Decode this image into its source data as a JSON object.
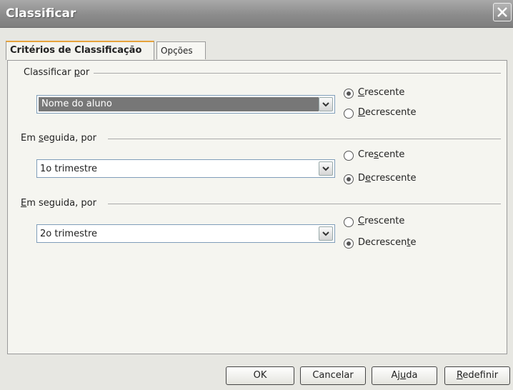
{
  "window": {
    "title": "Classificar"
  },
  "tabs": [
    {
      "label": "Critérios de Classificação"
    },
    {
      "label": "Opções"
    }
  ],
  "groups": [
    {
      "label_pre": "Classificar ",
      "label_key": "p",
      "label_post": "or",
      "select_value": "Nome do aluno",
      "asc": {
        "pre": "",
        "key": "C",
        "post": "rescente",
        "checked": true
      },
      "desc": {
        "pre": "",
        "key": "D",
        "post": "ecrescente",
        "checked": false
      }
    },
    {
      "label_pre": "Em ",
      "label_key": "s",
      "label_post": "eguida, por",
      "select_value": "1o trimestre",
      "asc": {
        "pre": "Cre",
        "key": "s",
        "post": "cente",
        "checked": false
      },
      "desc": {
        "pre": "D",
        "key": "e",
        "post": "crescente",
        "checked": true
      }
    },
    {
      "label_pre": "",
      "label_key": "E",
      "label_post": "m seguida, por",
      "select_value": "2o trimestre",
      "asc": {
        "pre": "",
        "key": "C",
        "post": "rescente",
        "checked": false
      },
      "desc": {
        "pre": "Decrescen",
        "key": "t",
        "post": "e",
        "checked": true
      }
    }
  ],
  "buttons": {
    "ok": "OK",
    "cancel": "Cancelar",
    "help_pre": "Aj",
    "help_key": "u",
    "help_post": "da",
    "reset_key": "R",
    "reset_post": "edefinir"
  }
}
